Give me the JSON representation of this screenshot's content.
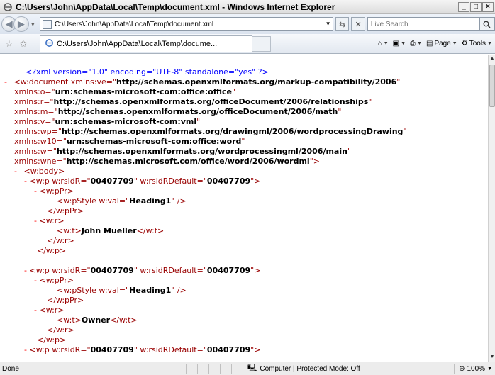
{
  "window": {
    "title": "C:\\Users\\John\\AppData\\Local\\Temp\\document.xml - Windows Internet Explorer",
    "min_label": "_",
    "max_label": "□",
    "close_label": "×"
  },
  "address": {
    "url": "C:\\Users\\John\\AppData\\Local\\Temp\\document.xml",
    "search_placeholder": "Live Search"
  },
  "tab": {
    "label": "C:\\Users\\John\\AppData\\Local\\Temp\\docume..."
  },
  "commands": {
    "page": "Page",
    "tools": "Tools"
  },
  "xml": {
    "decl": "<?xml version=\"1.0\" encoding=\"UTF-8\" standalone=\"yes\" ?>",
    "doc_open_pre": "<w:document xmlns:ve=\"",
    "ns_ve": "http://schemas.openxmlformats.org/markup-compatibility/2006",
    "ns_lines": [
      {
        "attr": "xmlns:o=\"",
        "val": "urn:schemas-microsoft-com:office:office",
        "end": "\""
      },
      {
        "attr": "xmlns:r=\"",
        "val": "http://schemas.openxmlformats.org/officeDocument/2006/relationships",
        "end": "\""
      },
      {
        "attr": "xmlns:m=\"",
        "val": "http://schemas.openxmlformats.org/officeDocument/2006/math",
        "end": "\""
      },
      {
        "attr": "xmlns:v=\"",
        "val": "urn:schemas-microsoft-com:vml",
        "end": "\""
      },
      {
        "attr": "xmlns:wp=\"",
        "val": "http://schemas.openxmlformats.org/drawingml/2006/wordprocessingDrawing",
        "end": "\""
      },
      {
        "attr": "xmlns:w10=\"",
        "val": "urn:schemas-microsoft-com:office:word",
        "end": "\""
      },
      {
        "attr": "xmlns:w=\"",
        "val": "http://schemas.openxmlformats.org/wordprocessingml/2006/main",
        "end": "\""
      },
      {
        "attr": "xmlns:wne=\"",
        "val": "http://schemas.microsoft.com/office/word/2006/wordml",
        "end": "\">"
      }
    ],
    "body_open": "<w:body>",
    "p_open_a": "<w:p w:rsidR=\"",
    "p_open_b": "\" w:rsidRDefault=\"",
    "p_open_c": "\">",
    "rsid": "00407709",
    "ppr_open": "<w:pPr>",
    "pstyle_a": "<w:pStyle w:val=\"",
    "pstyle_val": "Heading1",
    "pstyle_b": "\" />",
    "ppr_close": "</w:pPr>",
    "r_open": "<w:r>",
    "t_open": "<w:t>",
    "t_close": "</w:t>",
    "r_close": "</w:r>",
    "p_close": "</w:p>",
    "text1": "John Mueller",
    "text2": "Owner",
    "dash": "-"
  },
  "status": {
    "left": "Done",
    "zone": "Computer | Protected Mode: Off",
    "zoom": "100%"
  }
}
